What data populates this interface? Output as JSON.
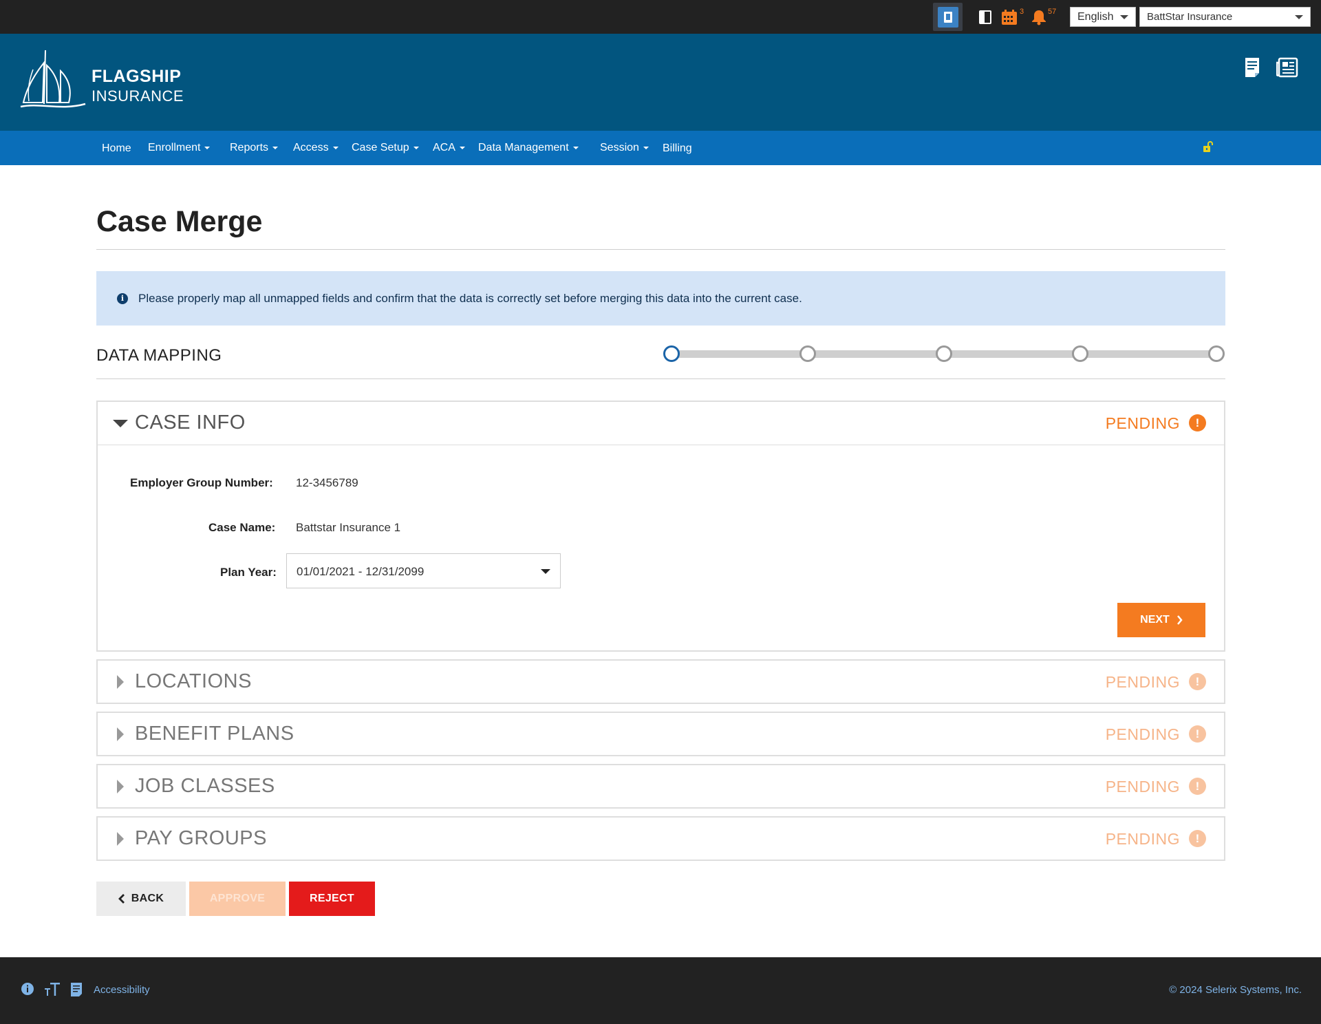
{
  "topbar": {
    "language": "English",
    "company": "BattStar Insurance",
    "calendar_badge": "3",
    "notification_badge": "57"
  },
  "header": {
    "logo_line1": "FLAGSHIP",
    "logo_line2": "INSURANCE"
  },
  "nav": {
    "items": [
      {
        "label": "Home"
      },
      {
        "label": "Enrollment"
      },
      {
        "label": "Reports"
      },
      {
        "label": "Access"
      },
      {
        "label": "Case Setup"
      },
      {
        "label": "ACA"
      },
      {
        "label": "Data Management"
      },
      {
        "label": "Session"
      },
      {
        "label": "Billing"
      }
    ]
  },
  "page": {
    "title": "Case Merge",
    "alert": "Please properly map all unmapped fields and confirm that the data is correctly set before merging this data into the current case.",
    "section_label": "DATA MAPPING",
    "steps_total": 5,
    "current_step": 1
  },
  "case_info": {
    "title": "CASE INFO",
    "status": "PENDING",
    "employer_group_label": "Employer Group Number:",
    "employer_group_value": "12-3456789",
    "case_name_label": "Case Name:",
    "case_name_value": "Battstar Insurance 1",
    "plan_year_label": "Plan Year:",
    "plan_year_value": "01/01/2021 - 12/31/2099",
    "next_label": "NEXT"
  },
  "panels": [
    {
      "title": "LOCATIONS",
      "status": "PENDING"
    },
    {
      "title": "BENEFIT PLANS",
      "status": "PENDING"
    },
    {
      "title": "JOB CLASSES",
      "status": "PENDING"
    },
    {
      "title": "PAY GROUPS",
      "status": "PENDING"
    }
  ],
  "actions": {
    "back": "BACK",
    "approve": "APPROVE",
    "reject": "REJECT"
  },
  "footer": {
    "accessibility": "Accessibility",
    "copyright": "© 2024 Selerix Systems, Inc."
  },
  "colors": {
    "header": "#02557f",
    "nav": "#0a6eb9",
    "accent": "#f47b20",
    "reject": "#e41b1b"
  }
}
